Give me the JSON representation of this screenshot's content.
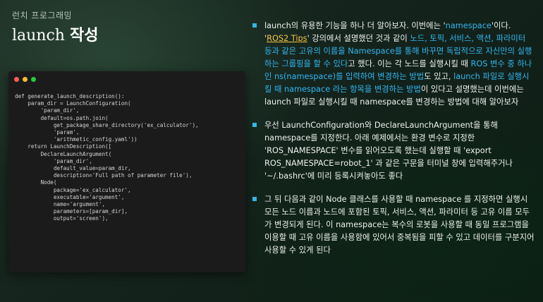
{
  "slide": {
    "subtitle": "런치 프로그래밍",
    "title_en": "launch",
    "title_ko": "작성"
  },
  "code_lines": [
    "def generate_launch_description():",
    "    param_dir = LaunchConfiguration(",
    "        'param_dir',",
    "        default=os.path.join(",
    "            get_package_share_directory('ex_calculator'),",
    "            'param',",
    "            'arithmetic_config.yaml'))",
    "",
    "    return LaunchDescription([",
    "        DeclareLaunchArgument(",
    "            'param_dir',",
    "            default_value=param_dir,",
    "            description='Full path of parameter file'),",
    "",
    "        Node(",
    "            package='ex_calculator',",
    "            executable='argument',",
    "            name='argument',",
    "            parameters=[param_dir],",
    "            output='screen'),"
  ],
  "bullets": {
    "b1": {
      "t1": "launch의 유용한 기능을 하나 더 알아보자. 이번에는 '",
      "t2": "namespace",
      "t3": "'이다. '",
      "t4": "ROS2 Tips",
      "t5": "' 강의에서 설명했던 것과 같이 ",
      "t6": "노드, 토픽, 서비스, 액션, 파라미터 등과 같은 고유의 이름을 Namespace를 통해 바꾸면 독립적으로 자신만의 실행하는 그룹핑을 할 수 있다",
      "t7": "고 했다. 이는 각 노드를 실행시킬 때 ",
      "t8": "ROS 변수 중 하나인 ns(namespace)를 입력하여 변경하는 방법",
      "t9": "도 있고, ",
      "t10": "launch 파일로 실행시킬 때 namespace 라는 항목을 변경하는 방법",
      "t11": "이 있다고 설명했는데 이번에는 launch 파일로 실행시킬 때 namespace를 변경하는 방법에 대해 알아보자"
    },
    "b2": "우선 LaunchConfiguration와 DeclareLaunchArgument을 통해 namespace를 지정한다. 아래 예제에서는 환경 변수로 지정한 'ROS_NAMESPACE' 변수를 읽어오도록 했는데 실행할 때 'export ROS_NAMESPACE=robot_1' 과 같은 구문을 터미널 창에 입력해주거나 '~/.bashrc'에 미리 등록시켜놓아도 좋다",
    "b3": "그 뒤 다음과 같이 Node 클래스를 사용할 때 namespace 를 지정하면 실행시 모든 노드 이름과 노드에 포함된 토픽, 서비스, 액션, 파라미터 등 고유 이름 모두가 변경되게 된다. 이 namespace는 복수의 로봇을 사용할 때 동일 프로그램을 이용할 때 고유 이름을 사용함에 있어서 중복됨을 피할 수 있고 데이터를 구분지어 사용할 수 있게 된다"
  }
}
